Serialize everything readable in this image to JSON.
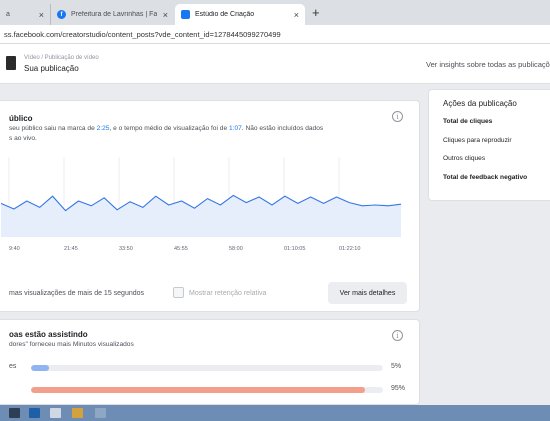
{
  "browser": {
    "tabs": [
      {
        "label": "a"
      },
      {
        "label": "Prefeitura de Lavrinhas | Facebo"
      },
      {
        "label": "Estúdio de Criação"
      }
    ],
    "new_tab": "+",
    "close_glyph": "×",
    "url": "ss.facebook.com/creatorstudio/content_posts?vde_content_id=1278445099270499"
  },
  "header": {
    "breadcrumb": "Vídeo / Publicação de vídeo",
    "title": "Sua publicação",
    "insights_link": "Ver insights sobre todas as publicaçõ"
  },
  "retention": {
    "title": "úblico",
    "line1_prefix": " seu público saiu na marca de ",
    "line1_time1": "2:25",
    "line1_mid": ", e o tempo médio de visualização foi de ",
    "line1_time2": "1:07",
    "line1_suffix": ". Não estão incluídos dados",
    "line2": "s ao vivo.",
    "info_icon": "i",
    "footer_text": "mas visualizações de mais de 15 segundos",
    "toggle_label": "Mostrar retenção relativa",
    "button": "Ver mais detalhes"
  },
  "chart_data": {
    "type": "line",
    "x_ticks": [
      "9:40",
      "21:45",
      "33:50",
      "45:55",
      "58:00",
      "01:10:05",
      "01:22:10"
    ],
    "series": [
      {
        "values": [
          0.42,
          0.35,
          0.45,
          0.37,
          0.51,
          0.33,
          0.45,
          0.39,
          0.49,
          0.34,
          0.44,
          0.37,
          0.51,
          0.4,
          0.45,
          0.36,
          0.48,
          0.4,
          0.52,
          0.43,
          0.5,
          0.4,
          0.51,
          0.42,
          0.5,
          0.42,
          0.5,
          0.43,
          0.39,
          0.4,
          0.39,
          0.41
        ]
      }
    ],
    "line_color": "#3578e5",
    "fill_color": "#e7eefb",
    "grid": true
  },
  "watching": {
    "title": "oas estão assistindo",
    "subtitle": "dores\" forneceu mais Minutos visualizados",
    "info_icon": "i",
    "bars": [
      {
        "label": "es",
        "value": 5,
        "pct_label": "5%",
        "color": "#8fb4f0"
      },
      {
        "label": "",
        "value": 95,
        "pct_label": "95%",
        "color": "#f2a08c"
      }
    ]
  },
  "actions": {
    "title": "Ações da publicação",
    "items": [
      {
        "label": "Total de cliques",
        "bold": true
      },
      {
        "label": "Cliques para reproduzir",
        "bold": false
      },
      {
        "label": "Outros cliques",
        "bold": false
      },
      {
        "label": "Total de feedback negativo",
        "bold": true
      }
    ]
  }
}
